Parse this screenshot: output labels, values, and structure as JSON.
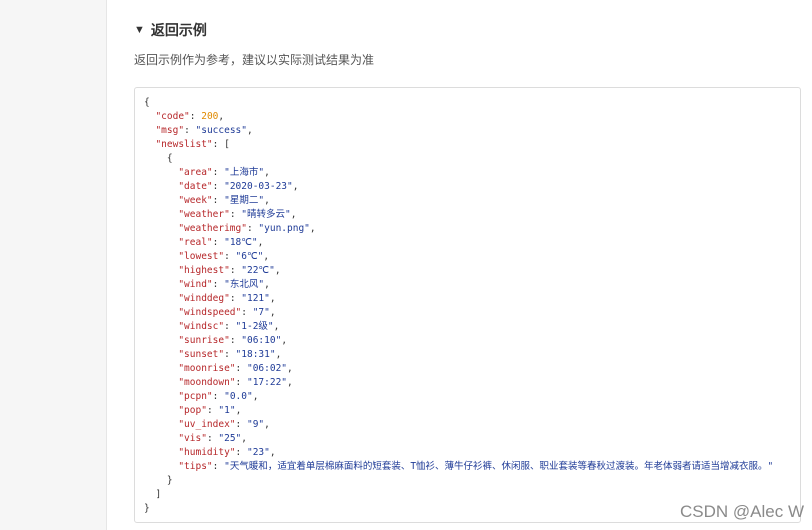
{
  "section": {
    "title": "返回示例",
    "subtitle": "返回示例作为参考，建议以实际测试结果为准"
  },
  "response": {
    "open_brace": "{",
    "code_key": "\"code\"",
    "code_value": "200",
    "msg_key": "\"msg\"",
    "msg_value": "\"success\"",
    "newslist_key": "\"newslist\"",
    "array_open": "[",
    "item_open": "{",
    "fields": [
      {
        "key": "\"area\"",
        "value": "\"上海市\""
      },
      {
        "key": "\"date\"",
        "value": "\"2020-03-23\""
      },
      {
        "key": "\"week\"",
        "value": "\"星期二\""
      },
      {
        "key": "\"weather\"",
        "value": "\"晴转多云\""
      },
      {
        "key": "\"weatherimg\"",
        "value": "\"yun.png\""
      },
      {
        "key": "\"real\"",
        "value": "\"18℃\""
      },
      {
        "key": "\"lowest\"",
        "value": "\"6℃\""
      },
      {
        "key": "\"highest\"",
        "value": "\"22℃\""
      },
      {
        "key": "\"wind\"",
        "value": "\"东北风\""
      },
      {
        "key": "\"winddeg\"",
        "value": "\"121\""
      },
      {
        "key": "\"windspeed\"",
        "value": "\"7\""
      },
      {
        "key": "\"windsc\"",
        "value": "\"1-2级\""
      },
      {
        "key": "\"sunrise\"",
        "value": "\"06:10\""
      },
      {
        "key": "\"sunset\"",
        "value": "\"18:31\""
      },
      {
        "key": "\"moonrise\"",
        "value": "\"06:02\""
      },
      {
        "key": "\"moondown\"",
        "value": "\"17:22\""
      },
      {
        "key": "\"pcpn\"",
        "value": "\"0.0\""
      },
      {
        "key": "\"pop\"",
        "value": "\"1\""
      },
      {
        "key": "\"uv_index\"",
        "value": "\"9\""
      },
      {
        "key": "\"vis\"",
        "value": "\"25\""
      },
      {
        "key": "\"humidity\"",
        "value": "\"23\""
      },
      {
        "key": "\"tips\"",
        "value": "\"天气暖和，适宜着单层棉麻面料的短套装、T恤衫、薄牛仔衫裤、休闲服、职业套装等春秋过渡装。年老体弱者请适当增减衣服。\""
      }
    ],
    "item_close": "}",
    "array_close": "]",
    "close_brace": "}"
  },
  "watermark": "CSDN @Alec W",
  "colors": {
    "key": "#b6272a",
    "string": "#1f3b97",
    "number": "#e08a00",
    "punctuation": "#333333"
  }
}
